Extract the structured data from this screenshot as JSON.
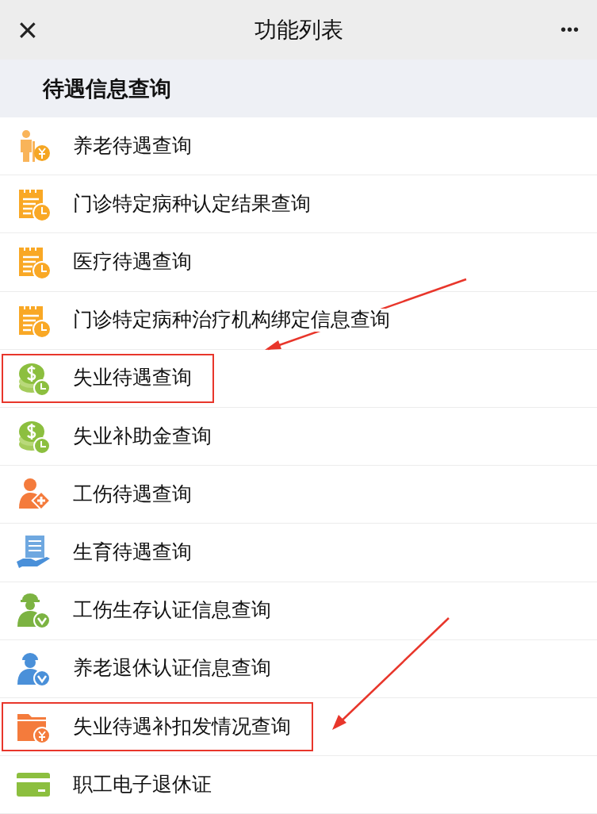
{
  "nav_bar": {
    "close": "×",
    "title": "功能列表",
    "more": "•••"
  },
  "section": {
    "title": "待遇信息查询"
  },
  "items": [
    {
      "label": "养老待遇查询",
      "kind": "elder",
      "highlighted": false
    },
    {
      "label": "门诊特定病种认定结果查询",
      "kind": "notepad",
      "highlighted": false
    },
    {
      "label": "医疗待遇查询",
      "kind": "notepad",
      "highlighted": false
    },
    {
      "label": "门诊特定病种治疗机构绑定信息查询",
      "kind": "notepad",
      "highlighted": false
    },
    {
      "label": "失业待遇查询",
      "kind": "coins",
      "highlighted": true
    },
    {
      "label": "失业补助金查询",
      "kind": "coins",
      "highlighted": false
    },
    {
      "label": "工伤待遇查询",
      "kind": "injury",
      "highlighted": false
    },
    {
      "label": "生育待遇查询",
      "kind": "maternity",
      "highlighted": false
    },
    {
      "label": "工伤生存认证信息查询",
      "kind": "worker",
      "highlighted": false
    },
    {
      "label": "养老退休认证信息查询",
      "kind": "retiree",
      "highlighted": false
    },
    {
      "label": "失业待遇补扣发情况查询",
      "kind": "folder",
      "highlighted": true
    },
    {
      "label": "职工电子退休证",
      "kind": "card",
      "highlighted": false
    }
  ]
}
